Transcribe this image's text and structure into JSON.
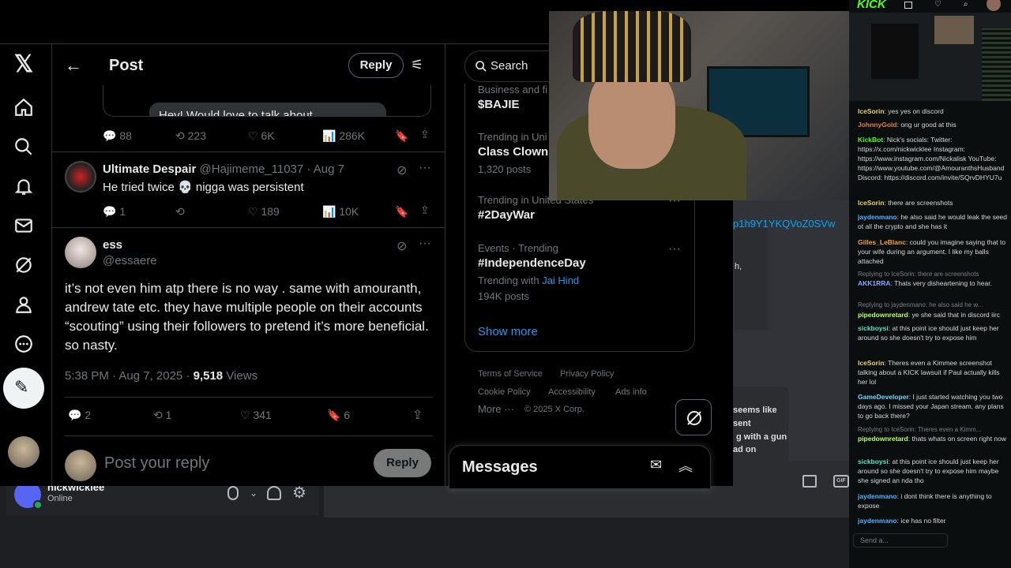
{
  "x": {
    "header": {
      "title": "Post",
      "reply_button": "Reply"
    },
    "quoted_snippet": "Hey! Would love to talk about",
    "top_post_stats": {
      "replies": "88",
      "reposts": "223",
      "likes": "6K",
      "views": "286K"
    },
    "reply1": {
      "name": "Ultimate Despair",
      "handle": "@Hajimeme_11037",
      "date": "· Aug 7",
      "text": "He tried twice 💀 nigga was persistent",
      "replies": "1",
      "likes": "189",
      "views": "10K"
    },
    "main_post": {
      "name": "ess",
      "handle": "@essaere",
      "text": "it’s not even him atp there is no way . same with amouranth, andrew tate etc. they have multiple people on their accounts “scouting” using their followers to pretend it’s more beneficial. so nasty.",
      "time": "5:38 PM · Aug 7, 2025 ·",
      "views_count": "9,518",
      "views_label": "Views",
      "replies": "2",
      "reposts": "1",
      "likes": "341",
      "bookmarks": "6"
    },
    "compose": {
      "placeholder": "Post your reply",
      "button": "Reply"
    },
    "search": {
      "placeholder": "Search"
    },
    "trends": [
      {
        "category": "Business and fi",
        "name": "$BAJIE",
        "extra": ""
      },
      {
        "category": "Trending in Uni",
        "name": "Class Clown",
        "extra": "1,320 posts"
      },
      {
        "category": "Trending in United States",
        "name": "#2DayWar",
        "extra": ""
      },
      {
        "category": "Events · Trending",
        "name": "#IndependenceDay",
        "extra": "194K posts",
        "with_label": "Trending with",
        "with_link": "Jai Hind"
      }
    ],
    "show_more": "Show more",
    "footer": {
      "terms": "Terms of Service",
      "privacy": "Privacy Policy",
      "cookie": "Cookie Policy",
      "accessibility": "Accessibility",
      "ads": "Ads info",
      "more": "More ···",
      "copyright": "© 2025 X Corp."
    },
    "messages": "Messages"
  },
  "discord": {
    "username": "nickwicklee",
    "status": "Online",
    "link_fragment": "p1h9Y1YKQVoZ0SVw",
    "bubble_fragment": "h,",
    "right_fragments": [
      "seems like",
      "sent",
      "g with a gun",
      "ad on"
    ]
  },
  "kick": {
    "logo": "KICK",
    "chat": [
      {
        "name": "IceSorin",
        "color": "#e6d16b",
        "text": ": yes yes on discord"
      },
      {
        "name": "JohnnyGold",
        "color": "#e97d3b",
        "text": ": ong ur good at this"
      },
      {
        "name": "KickBot",
        "color": "#53fc18",
        "text": ": Nick's socials: Twitter: https://x.com/nickwicklee Instagram: https://www.instagram.com/Nickalisk YouTube: https://www.youtube.com/@AmouranthsHusband Discord: https://discord.com/invite/SQrvDHYU7u"
      },
      {
        "name": "IceSorin",
        "color": "#e6d16b",
        "text": ": there are screenshots"
      },
      {
        "name": "jaydenmano",
        "color": "#4fb3ff",
        "text": ": he also said he would leak the seed ot all the crypto and she has it"
      },
      {
        "name": "Gilles_LeBlanc",
        "color": "#f0a33b",
        "text": ": could you imagine saying that to your wife during an argument. I like my balls attached"
      },
      {
        "reply": "Replying to IceSorin: there are screenshots",
        "name": "AKK1RRA",
        "color": "#8aa7ff",
        "text": ": Thats very disheartening to hear."
      },
      {
        "reply": "Replying to jaydenmano: he also said he w...",
        "name": "pipedownretard",
        "color": "#b8ff6b",
        "text": ": ye she said that in discord iirc"
      },
      {
        "name": "sickboysi",
        "color": "#5ee0c0",
        "text": ": at this point ice should just keep her around so she doesn't try to expose him"
      },
      {
        "name": "IceSorin",
        "color": "#e6d16b",
        "text": ": Theres even a Kimmee screenshot talking about a KICK lawsuit if Paul actually kills her lol"
      },
      {
        "name": "GameDeveloper",
        "color": "#6fd7ff",
        "text": ": I just started watching you two days ago. I missed your Japan stream, any plans to go back there?"
      },
      {
        "reply": "Replying to IceSorin: Theres even a Kimm...",
        "name": "pipedownretard",
        "color": "#b8ff6b",
        "text": ": thats whats on screen right now"
      },
      {
        "name": "sickboysi",
        "color": "#5ee0c0",
        "text": ": at this point ice should just keep her around so she doesn't try to expose him maybe she signed an nda tho"
      },
      {
        "name": "jaydenmano",
        "color": "#4fb3ff",
        "text": ": i dont think there is anything to expose"
      },
      {
        "name": "jaydenmano",
        "color": "#4fb3ff",
        "text": ": ice has no filter"
      }
    ],
    "send_placeholder": "Send a..."
  },
  "colors": {
    "x_blue": "#1d9bf0",
    "kick_green": "#53fc18",
    "bg": "#000000"
  }
}
